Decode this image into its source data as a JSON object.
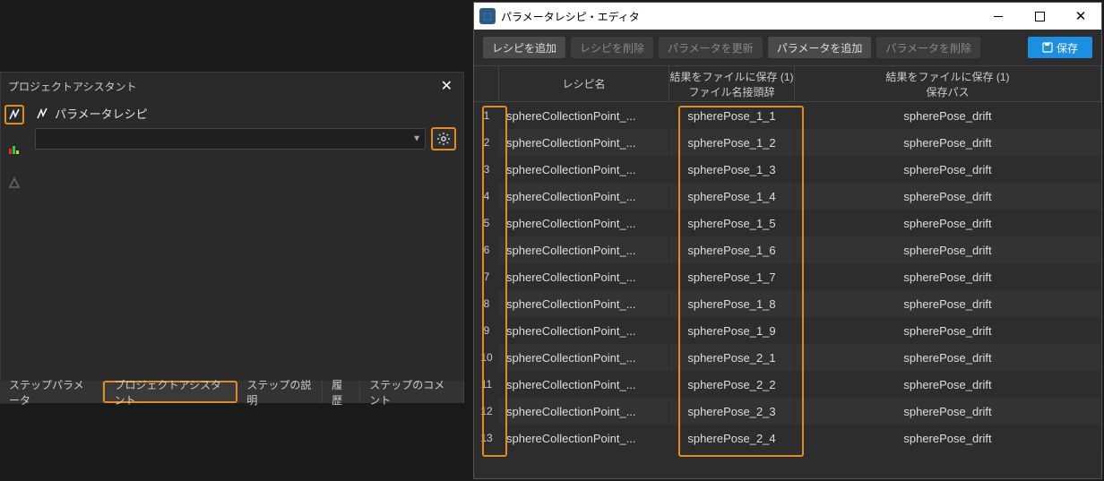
{
  "leftPanel": {
    "title": "プロジェクトアシスタント",
    "recipeLabel": "パラメータレシピ",
    "dropdownValue": ""
  },
  "bottomTabs": [
    {
      "label": "ステップパラメータ",
      "active": false
    },
    {
      "label": "プロジェクトアシスタント",
      "active": true
    },
    {
      "label": "ステップの説明",
      "active": false
    },
    {
      "label": "履歴",
      "active": false
    },
    {
      "label": "ステップのコメント",
      "active": false
    }
  ],
  "rightWindow": {
    "title": "パラメータレシピ・エディタ",
    "toolbar": {
      "addRecipe": "レシピを追加",
      "delRecipe": "レシピを削除",
      "updParam": "パラメータを更新",
      "addParam": "パラメータを追加",
      "delParam": "パラメータを削除",
      "save": "保存"
    },
    "headers": {
      "name": "レシピ名",
      "prefixLine1": "結果をファイルに保存 (1)",
      "prefixLine2": "ファイル名接頭辞",
      "pathLine1": "結果をファイルに保存 (1)",
      "pathLine2": "保存パス"
    },
    "rows": [
      {
        "n": "1",
        "name": "sphereCollectionPoint_...",
        "prefix": "spherePose_1_1",
        "path": "spherePose_drift"
      },
      {
        "n": "2",
        "name": "sphereCollectionPoint_...",
        "prefix": "spherePose_1_2",
        "path": "spherePose_drift"
      },
      {
        "n": "3",
        "name": "sphereCollectionPoint_...",
        "prefix": "spherePose_1_3",
        "path": "spherePose_drift"
      },
      {
        "n": "4",
        "name": "sphereCollectionPoint_...",
        "prefix": "spherePose_1_4",
        "path": "spherePose_drift"
      },
      {
        "n": "5",
        "name": "sphereCollectionPoint_...",
        "prefix": "spherePose_1_5",
        "path": "spherePose_drift"
      },
      {
        "n": "6",
        "name": "sphereCollectionPoint_...",
        "prefix": "spherePose_1_6",
        "path": "spherePose_drift"
      },
      {
        "n": "7",
        "name": "sphereCollectionPoint_...",
        "prefix": "spherePose_1_7",
        "path": "spherePose_drift"
      },
      {
        "n": "8",
        "name": "sphereCollectionPoint_...",
        "prefix": "spherePose_1_8",
        "path": "spherePose_drift"
      },
      {
        "n": "9",
        "name": "sphereCollectionPoint_...",
        "prefix": "spherePose_1_9",
        "path": "spherePose_drift"
      },
      {
        "n": "10",
        "name": "sphereCollectionPoint_...",
        "prefix": "spherePose_2_1",
        "path": "spherePose_drift"
      },
      {
        "n": "11",
        "name": "sphereCollectionPoint_...",
        "prefix": "spherePose_2_2",
        "path": "spherePose_drift"
      },
      {
        "n": "12",
        "name": "sphereCollectionPoint_...",
        "prefix": "spherePose_2_3",
        "path": "spherePose_drift"
      },
      {
        "n": "13",
        "name": "sphereCollectionPoint_...",
        "prefix": "spherePose_2_4",
        "path": "spherePose_drift"
      }
    ]
  }
}
